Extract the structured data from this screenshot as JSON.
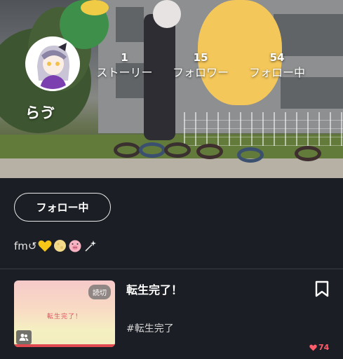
{
  "profile": {
    "username": "らゔ",
    "stats": [
      {
        "count": "1",
        "label": "ストーリー"
      },
      {
        "count": "15",
        "label": "フォロワー"
      },
      {
        "count": "54",
        "label": "フォロー中"
      }
    ],
    "follow_button_label": "フォロー中",
    "bio": {
      "prefix": "fm↺",
      "emojis": [
        "yellow-heart",
        "moon",
        "pig-face",
        "sparkle-wand"
      ]
    }
  },
  "story": {
    "title": "転生完了！",
    "hashtag": "#転生完了",
    "thumbnail_title": "転生完了！",
    "badge": "読切",
    "likes": "74"
  },
  "colors": {
    "background": "#1b1e24",
    "like": "#ff5c6c",
    "divider": "#3a3d44"
  }
}
